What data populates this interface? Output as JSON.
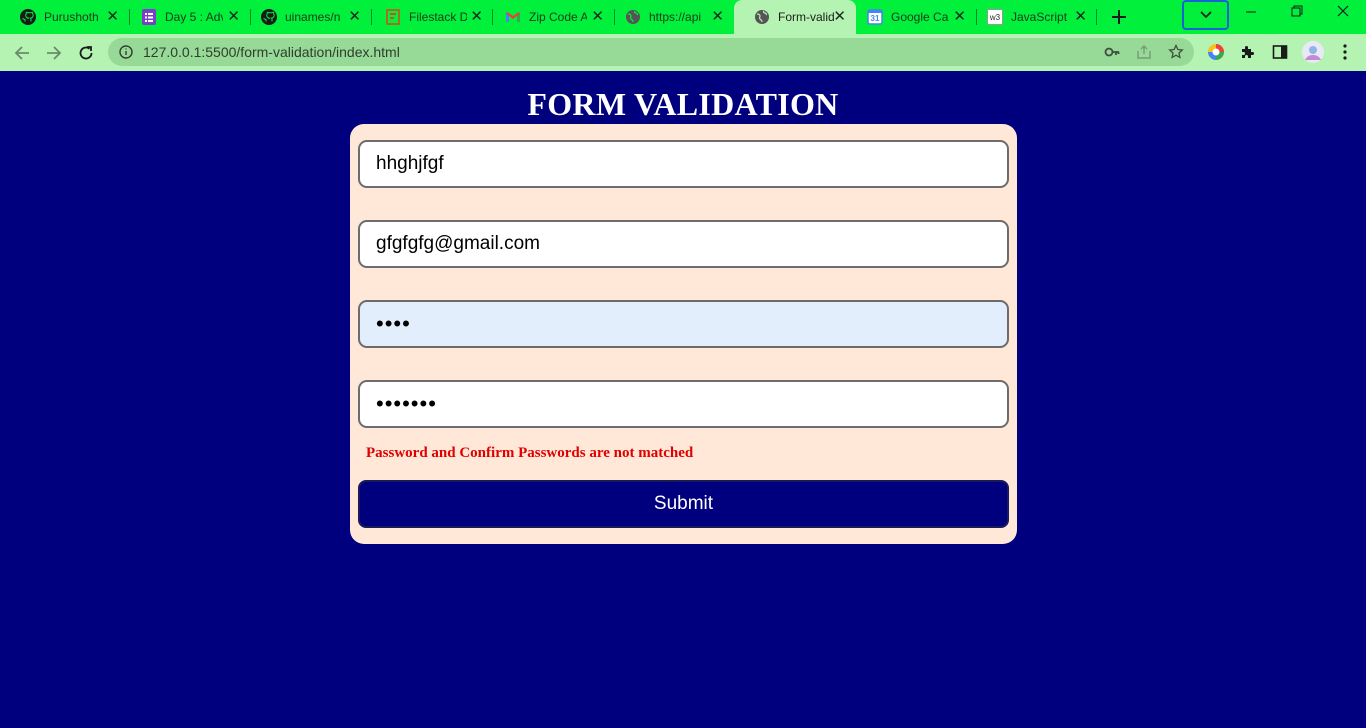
{
  "browser": {
    "tabs": [
      {
        "title": "Purushoth",
        "icon": "github-icon"
      },
      {
        "title": "Day 5 : Adv",
        "icon": "forms-icon"
      },
      {
        "title": "uinames/n",
        "icon": "github-icon"
      },
      {
        "title": "Filestack D",
        "icon": "filestack-icon"
      },
      {
        "title": "Zip Code A",
        "icon": "gmail-icon"
      },
      {
        "title": "https://api",
        "icon": "globe-icon"
      },
      {
        "title": "Form-valid",
        "icon": "globe-icon",
        "active": true
      },
      {
        "title": "Google Cal",
        "icon": "calendar-icon"
      },
      {
        "title": "JavaScript",
        "icon": "w3schools-icon"
      }
    ],
    "url": "127.0.0.1:5500/form-validation/index.html",
    "calendar_day": "31",
    "w3_label": "w3",
    "colors": {
      "tabbar": "#00f03c",
      "toolbar": "#b5f3b2",
      "page_background": "#00007e",
      "form_card": "#ffe8d8",
      "error": "#e00000"
    }
  },
  "page": {
    "heading": "FORM VALIDATION",
    "fields": {
      "username": "hhghjfgf",
      "email": "gfgfgfg@gmail.com",
      "password": "••••",
      "confirm_password": "•••••••"
    },
    "error_message": "Password and Confirm Passwords are not matched",
    "submit_label": "Submit"
  }
}
